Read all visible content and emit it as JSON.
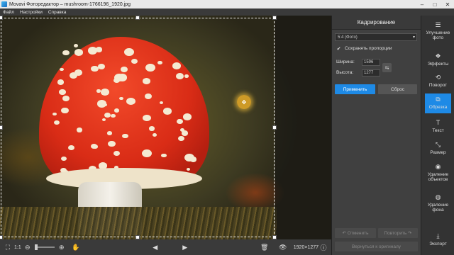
{
  "window": {
    "title": "Movavi Фоторедактор – mushroom-1766196_1920.jpg",
    "minimize": "–",
    "maximize": "□",
    "close": "✕"
  },
  "menu": [
    "Файл",
    "Настройки",
    "Справка"
  ],
  "status": {
    "zoom_label": "1:1",
    "dimensions": "1920×1277",
    "prev": "◀",
    "next": "▶"
  },
  "panel": {
    "title": "Кадрирование",
    "ratio": "5:4 (Фото)",
    "keep_proportions": "Сохранять пропорции",
    "width_label": "Ширина:",
    "width_value": "1596",
    "height_label": "Высота:",
    "height_value": "1277",
    "apply": "Применить",
    "reset": "Сброс",
    "undo": "Отменить",
    "redo": "Повторить",
    "revert": "Вернуться к оригиналу"
  },
  "tools": [
    {
      "label": "Улучшение фото",
      "icon": "sliders-icon"
    },
    {
      "label": "Эффекты",
      "icon": "effects-icon"
    },
    {
      "label": "Поворот",
      "icon": "rotate-icon"
    },
    {
      "label": "Обрезка",
      "icon": "crop-icon",
      "active": true
    },
    {
      "label": "Текст",
      "icon": "text-icon"
    },
    {
      "label": "Размер",
      "icon": "resize-icon"
    },
    {
      "label": "Удаление объектов",
      "icon": "eraser-icon"
    },
    {
      "label": "Удаление фона",
      "icon": "background-icon"
    },
    {
      "label": "Экспорт",
      "icon": "export-icon"
    }
  ],
  "colors": {
    "accent": "#1e8ae6",
    "panel": "#404040",
    "toolbar": "#333333"
  }
}
